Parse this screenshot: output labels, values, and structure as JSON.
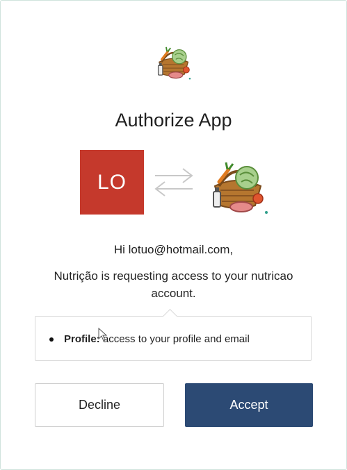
{
  "dialog": {
    "title": "Authorize App",
    "user_initials": "LO",
    "greeting": "Hi lotuo@hotmail.com,",
    "request_message": "Nutrição is requesting access to your nutricao account.",
    "scopes": [
      {
        "name": "Profile:",
        "description": "access to your profile and email"
      }
    ],
    "decline_label": "Decline",
    "accept_label": "Accept"
  },
  "colors": {
    "avatar_bg": "#c5392c",
    "accept_bg": "#2c4a74",
    "frame_border": "#cfe3dc"
  },
  "icons": {
    "app_logo": "vegetable-basket-logo",
    "exchange": "exchange-arrows-icon",
    "bullet": "bullet-icon",
    "cursor": "mouse-cursor-icon"
  }
}
